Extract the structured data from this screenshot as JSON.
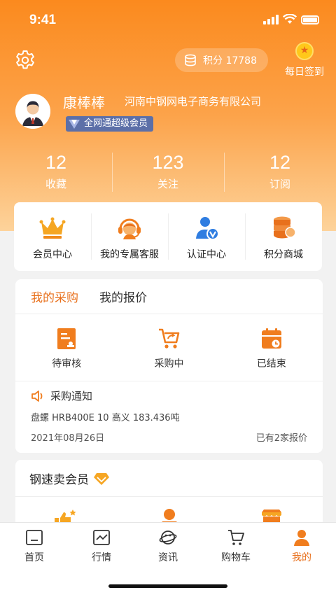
{
  "status_bar": {
    "time": "9:41"
  },
  "header": {
    "points_label": "积分 17788",
    "checkin_label": "每日签到",
    "user_name": "康棒棒",
    "company": "河南中钢网电子商务有限公司",
    "member_badge": "全网通超级会员"
  },
  "stats": [
    {
      "value": "12",
      "label": "收藏"
    },
    {
      "value": "123",
      "label": "关注"
    },
    {
      "value": "12",
      "label": "订阅"
    }
  ],
  "quick_menu": [
    {
      "label": "会员中心",
      "icon": "crown-icon"
    },
    {
      "label": "我的专属客服",
      "icon": "customer-service-icon"
    },
    {
      "label": "认证中心",
      "icon": "verified-user-icon"
    },
    {
      "label": "积分商城",
      "icon": "coin-stack-icon"
    }
  ],
  "purchase": {
    "tabs": [
      "我的采购",
      "我的报价"
    ],
    "states": [
      {
        "label": "待审核",
        "icon": "pending-review-icon"
      },
      {
        "label": "采购中",
        "icon": "cart-icon"
      },
      {
        "label": "已结束",
        "icon": "calendar-ended-icon"
      }
    ],
    "notice_title": "采购通知",
    "notice_detail": "盘螺 HRB400E 10 高义 183.436吨",
    "notice_date": "2021年08月26日",
    "notice_quotes": "已有2家报价"
  },
  "member_section": {
    "title": "钢速卖会员"
  },
  "tab_bar": [
    {
      "label": "首页",
      "icon": "home-icon"
    },
    {
      "label": "行情",
      "icon": "chart-icon"
    },
    {
      "label": "资讯",
      "icon": "news-planet-icon"
    },
    {
      "label": "购物车",
      "icon": "cart-icon"
    },
    {
      "label": "我的",
      "icon": "profile-icon"
    }
  ],
  "colors": {
    "accent": "#e8701c",
    "header_top": "#fb8a1e",
    "badge": "#5c6fa8"
  }
}
